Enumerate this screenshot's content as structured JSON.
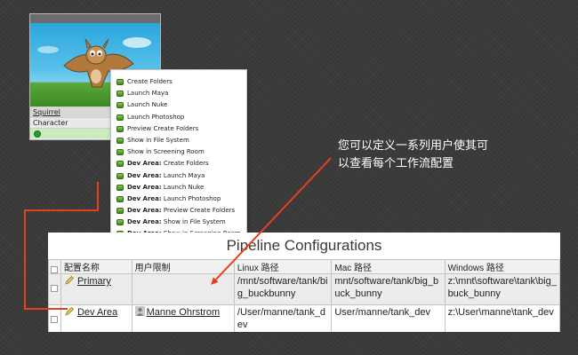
{
  "asset_card": {
    "name": "Squirrel",
    "type": "Character",
    "thumbnail_icon": "flying-squirrel-thumbnail"
  },
  "context_menu": {
    "items": [
      {
        "prefix": "",
        "label": "Create Folders"
      },
      {
        "prefix": "",
        "label": "Launch Maya"
      },
      {
        "prefix": "",
        "label": "Launch Nuke"
      },
      {
        "prefix": "",
        "label": "Launch Photoshop"
      },
      {
        "prefix": "",
        "label": "Preview Create Folders"
      },
      {
        "prefix": "",
        "label": "Show in File System"
      },
      {
        "prefix": "",
        "label": "Show in Screening Room"
      },
      {
        "prefix": "Dev Area:",
        "label": " Create Folders"
      },
      {
        "prefix": "Dev Area:",
        "label": " Launch Maya"
      },
      {
        "prefix": "Dev Area:",
        "label": " Launch Nuke"
      },
      {
        "prefix": "Dev Area:",
        "label": " Launch Photoshop"
      },
      {
        "prefix": "Dev Area:",
        "label": " Preview Create Folders"
      },
      {
        "prefix": "Dev Area:",
        "label": " Show in File System"
      },
      {
        "prefix": "Dev Area:",
        "label": " Show in Screening Room"
      }
    ]
  },
  "annotation": {
    "line1": "您可以定义一系列用户使其可",
    "line2": "以查看每个工作流配置"
  },
  "pipeline": {
    "title": "Pipeline Configurations",
    "columns": [
      "配置名称",
      "用户限制",
      "Linux 路径",
      "Mac 路径",
      "Windows 路径"
    ],
    "rows": [
      {
        "name": "Primary",
        "users": "",
        "linux": "/mnt/software/tank/big_buckbunny",
        "mac": "mnt/software/tank/big_buck_bunny",
        "windows": "z:\\mnt\\software\\tank\\big_buck_bunny"
      },
      {
        "name": "Dev Area",
        "users": "Manne Ohrstrom",
        "linux": "/User/manne/tank_dev",
        "mac": "User/manne/tank_dev",
        "windows": "z:\\User\\manne\\tank_dev"
      }
    ]
  },
  "colors": {
    "annotation_arrow": "#e8401c",
    "status_ok": "#2f9a2f",
    "menu_icon": "#4e9a26"
  }
}
